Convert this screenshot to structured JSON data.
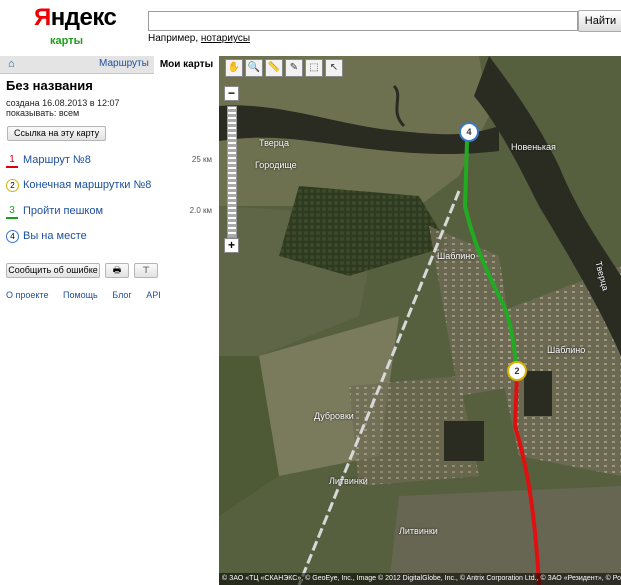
{
  "header": {
    "logo_text_first": "Я",
    "logo_text_rest": "ндекс",
    "logo_sub": "карты",
    "search_placeholder": "",
    "search_button": "Найти",
    "example_prefix": "Например,",
    "example_link": "нотариусы"
  },
  "sidebar": {
    "tabs": {
      "home_icon": "⌂",
      "routes": "Маршруты",
      "mymaps": "Мои карты"
    },
    "title": "Без названия",
    "created": "создана 16.08.2013 в 12:07",
    "visibility": "показывать: всем",
    "link_button": "Ссылка на эту карту",
    "items": [
      {
        "num": "1",
        "label": "Маршрут №8",
        "dist": "25 км",
        "color": "#d9000d",
        "style": "line"
      },
      {
        "num": "2",
        "label": "Конечная маршрутки №8",
        "dist": "",
        "color": "#d6b300",
        "style": "circle"
      },
      {
        "num": "3",
        "label": "Пройти пешком",
        "dist": "2.0 км",
        "color": "#1aa01a",
        "style": "line"
      },
      {
        "num": "4",
        "label": "Вы на месте",
        "dist": "",
        "color": "#3a78c4",
        "style": "circle"
      }
    ],
    "report_button": "Сообщить об ошибке",
    "print_icon": "printer-icon",
    "print_glyph": "🖶",
    "pin_glyph": "⊤",
    "footer": [
      "О проекте",
      "Помощь",
      "Блог",
      "API"
    ]
  },
  "map": {
    "toolbar_glyphs": [
      "✋",
      "🔍",
      "📏",
      "✎",
      "⬚",
      "↖"
    ],
    "zoom_in": "+",
    "zoom_out": "−",
    "places": {
      "tverca_top": "Тверца",
      "gorodishche": "Городище",
      "novenkaya": "Новенькая",
      "tverca_right": "Тверца",
      "shablino_station": "Шаблино",
      "shablino": "Шаблино",
      "dubrovki": "Дубровки",
      "litvinki_station": "Литвинки",
      "litvinki": "Литвинки"
    },
    "markers": {
      "end": "4",
      "stop": "2"
    },
    "copyright": "© ЗАО «ТЦ «СКАНЭКС», © GeoEye, Inc., Image © 2012 DigitalGlobe, Inc., © Antrix Corporation Ltd., © ЗАО «Резидент», © Роскартография",
    "colors": {
      "red_route": "#e01010",
      "green_route": "#22aa22",
      "river": "#2a2c22"
    }
  }
}
